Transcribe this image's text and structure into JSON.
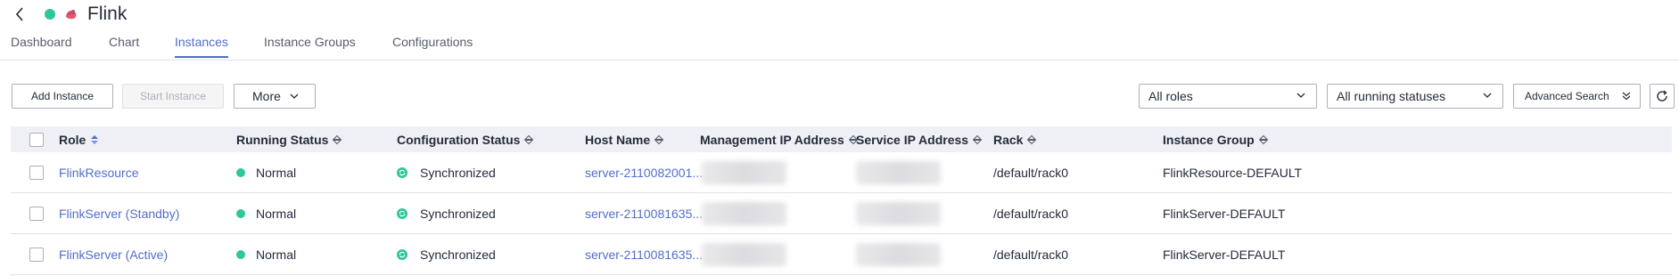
{
  "header": {
    "title": "Flink",
    "status_color": "#2ec79a"
  },
  "tabs": [
    {
      "label": "Dashboard",
      "active": false
    },
    {
      "label": "Chart",
      "active": false
    },
    {
      "label": "Instances",
      "active": true
    },
    {
      "label": "Instance Groups",
      "active": false
    },
    {
      "label": "Configurations",
      "active": false
    }
  ],
  "toolbar": {
    "add_instance": "Add Instance",
    "start_instance": "Start Instance",
    "more": "More",
    "roles_filter": "All roles",
    "status_filter": "All running statuses",
    "advanced_search": "Advanced Search"
  },
  "table": {
    "columns": [
      "Role",
      "Running Status",
      "Configuration Status",
      "Host Name",
      "Management IP Address",
      "Service IP Address",
      "Rack",
      "Instance Group"
    ],
    "rows": [
      {
        "role": "FlinkResource",
        "running_status": "Normal",
        "config_status": "Synchronized",
        "host_name": "server-2110082001...",
        "rack": "/default/rack0",
        "instance_group": "FlinkResource-DEFAULT"
      },
      {
        "role": "FlinkServer (Standby)",
        "running_status": "Normal",
        "config_status": "Synchronized",
        "host_name": "server-2110081635...",
        "rack": "/default/rack0",
        "instance_group": "FlinkServer-DEFAULT"
      },
      {
        "role": "FlinkServer (Active)",
        "running_status": "Normal",
        "config_status": "Synchronized",
        "host_name": "server-2110081635...",
        "rack": "/default/rack0",
        "instance_group": "FlinkServer-DEFAULT"
      }
    ]
  },
  "colors": {
    "accent": "#526ecc",
    "normal": "#2ec79a",
    "header_bg": "#eef0f5"
  }
}
